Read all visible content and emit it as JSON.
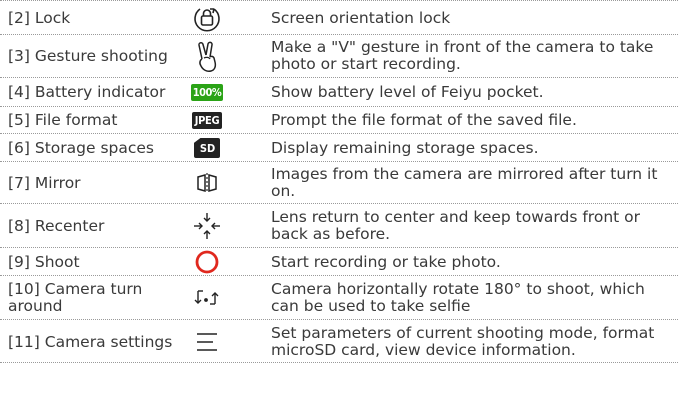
{
  "rows": [
    {
      "label": "[2] Lock",
      "desc": "Screen orientation lock",
      "icon": "lock-rotation-icon"
    },
    {
      "label": "[3] Gesture shooting",
      "desc": "Make a \"V\" gesture in front of the camera to take photo or start recording.",
      "icon": "v-gesture-icon"
    },
    {
      "label": "[4] Battery indicator",
      "desc": "Show battery level of Feiyu pocket.",
      "icon": "battery-badge-icon",
      "badge": "100%"
    },
    {
      "label": "[5] File format",
      "desc": "Prompt the file format of the saved file.",
      "icon": "jpeg-badge-icon",
      "badge": "JPEG"
    },
    {
      "label": "[6] Storage spaces",
      "desc": "Display remaining storage spaces.",
      "icon": "sd-card-icon",
      "badge": "SD"
    },
    {
      "label": "[7] Mirror",
      "desc": "Images from the camera are mirrored after turn it on.",
      "icon": "mirror-icon"
    },
    {
      "label": "[8] Recenter",
      "desc": "Lens return to center and keep towards front or back as before.",
      "icon": "recenter-icon"
    },
    {
      "label": "[9] Shoot",
      "desc": "Start recording or take photo.",
      "icon": "shoot-circle-icon"
    },
    {
      "label": "[10] Camera turn around",
      "desc": "Camera horizontally rotate 180° to shoot, which can be used to take selfie",
      "icon": "camera-turn-around-icon"
    },
    {
      "label": "[11] Camera settings",
      "desc": "Set parameters of current shooting mode, format microSD card, view device information.",
      "icon": "menu-lines-icon"
    }
  ],
  "colors": {
    "battery": "#2aa316",
    "badge_dark": "#222222",
    "shoot": "#e0281e"
  }
}
